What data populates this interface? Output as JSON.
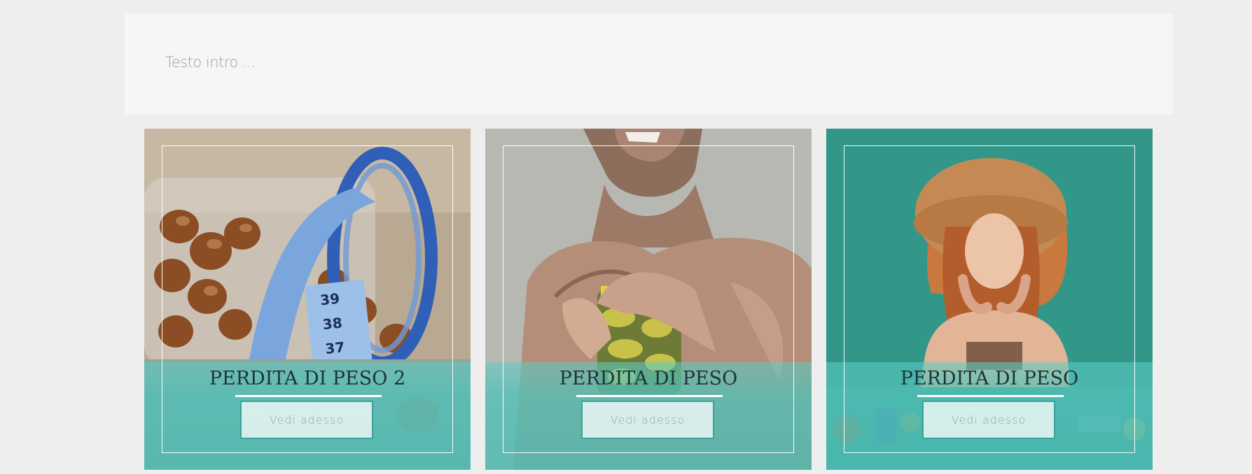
{
  "intro": {
    "text": "Testo intro ..."
  },
  "cards": [
    {
      "title": "PERDITA DI PESO 2",
      "button": "Vedi adesso",
      "image": "hazelnuts-measuring-tape-photo"
    },
    {
      "title": "PERDITA DI PESO",
      "button": "Vedi adesso",
      "image": "man-opening-pickle-jar-photo"
    },
    {
      "title": "PERDITA DI PESO",
      "button": "Vedi adesso",
      "image": "woman-straw-hat-teal-photo"
    }
  ],
  "colors": {
    "accent": "#4dbcb3",
    "title": "#1e3436",
    "page_bg": "#eeeeee",
    "intro_bg": "#f6f6f6"
  }
}
